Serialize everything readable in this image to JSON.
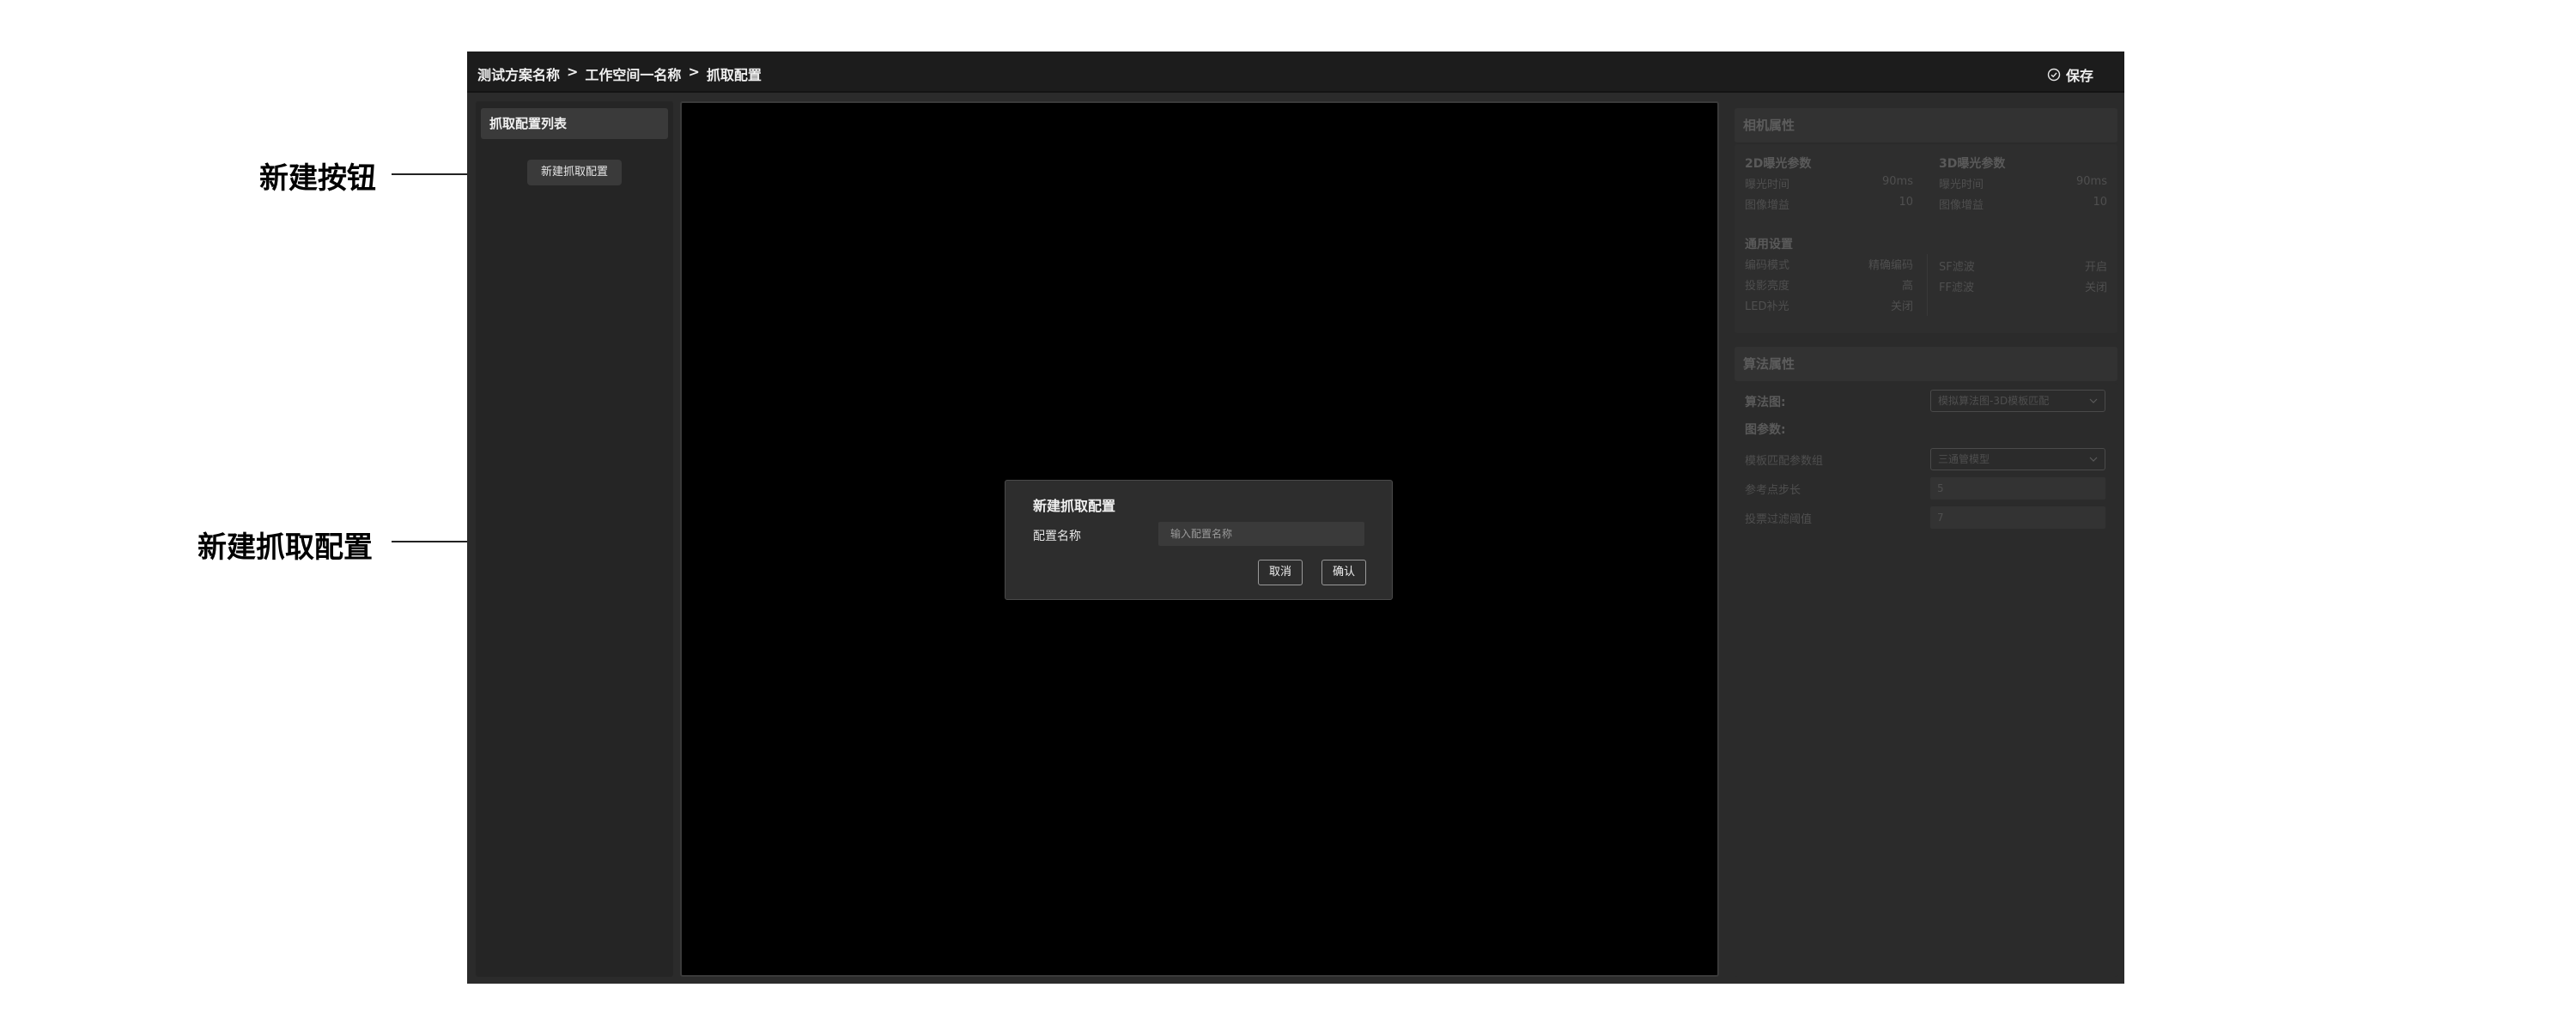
{
  "annotations": {
    "new_button": "新建按钮",
    "new_config": "新建抓取配置"
  },
  "header": {
    "breadcrumb": [
      "测试方案名称",
      ">",
      "工作空间一名称",
      ">",
      "抓取配置"
    ],
    "save_label": "保存"
  },
  "left_panel": {
    "title": "抓取配置列表",
    "new_button_label": "新建抓取配置"
  },
  "dialog": {
    "title": "新建抓取配置",
    "name_label": "配置名称",
    "name_placeholder": "输入配置名称",
    "name_value": "",
    "cancel_label": "取消",
    "confirm_label": "确认"
  },
  "camera": {
    "title": "相机属性",
    "exposure2d": {
      "title": "2D曝光参数",
      "items": [
        {
          "label": "曝光时间",
          "value": "90ms"
        },
        {
          "label": "图像增益",
          "value": "10"
        }
      ]
    },
    "exposure3d": {
      "title": "3D曝光参数",
      "items": [
        {
          "label": "曝光时间",
          "value": "90ms"
        },
        {
          "label": "图像增益",
          "value": "10"
        }
      ]
    },
    "general": {
      "title": "通用设置",
      "left": [
        {
          "label": "编码模式",
          "value": "精确编码"
        },
        {
          "label": "投影亮度",
          "value": "高"
        },
        {
          "label": "LED补光",
          "value": "关闭"
        }
      ],
      "right": [
        {
          "label": "SF滤波",
          "value": "开启"
        },
        {
          "label": "FF滤波",
          "value": "关闭"
        }
      ]
    }
  },
  "algorithm": {
    "title": "算法属性",
    "graph_label": "算法图:",
    "graph_value": "模拟算法图-3D模板匹配",
    "params_label": "图参数:",
    "rows": [
      {
        "label": "模板匹配参数组",
        "value": "三通管模型",
        "type": "select"
      },
      {
        "label": "参考点步长",
        "value": "5",
        "type": "field"
      },
      {
        "label": "投票过滤阈值",
        "value": "7",
        "type": "field"
      }
    ]
  },
  "colors": {
    "topbar": "#1c1c1c",
    "app_bg": "#2b2b2b",
    "canvas": "#000000",
    "dialog": "#2d2d2d"
  }
}
